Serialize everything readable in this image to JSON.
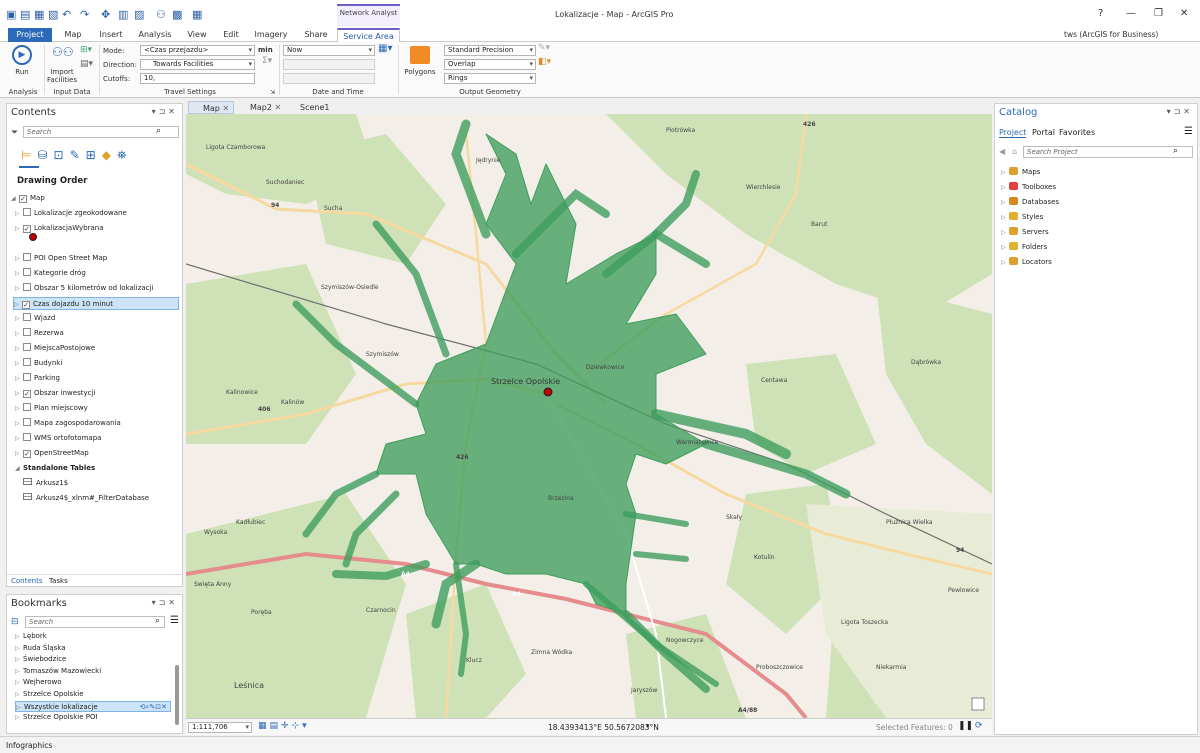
{
  "app": {
    "title": "Lokalizacje - Map - ArcGIS Pro",
    "context_group": "Network Analyst",
    "help": "?",
    "user": "tws (ArcGIS for Business)"
  },
  "ribbon": {
    "tabs": [
      "Project",
      "Map",
      "Insert",
      "Analysis",
      "View",
      "Edit",
      "Imagery",
      "Share",
      "Service Area"
    ],
    "run_label": "Run",
    "import_label": "Import\nFacilities",
    "groups": {
      "analysis": "Analysis",
      "input_data": "Input Data",
      "travel_settings": "Travel Settings",
      "date_time": "Date and Time",
      "output_geometry": "Output Geometry"
    },
    "mode_label": "Mode:",
    "mode_value": "<Czas przejazdu>",
    "mode_unit": "min",
    "direction_label": "Direction:",
    "direction_value": "Towards Facilities",
    "cutoffs_label": "Cutoffs:",
    "cutoffs_value": "10,",
    "date_value": "Now",
    "polygons_label": "Polygons",
    "precision_value": "Standard Precision",
    "overlap_value": "Overlap",
    "rings_value": "Rings"
  },
  "contents": {
    "title": "Contents",
    "search_placeholder": "Search",
    "drawing_order": "Drawing Order",
    "map_label": "Map",
    "layers": [
      {
        "name": "Lokalizacje zgeokodowane",
        "checked": false
      },
      {
        "name": "LokalizacjaWybrana",
        "checked": true
      },
      {
        "name": "POI Open Street Map",
        "checked": false
      },
      {
        "name": "Kategorie dróg",
        "checked": false
      },
      {
        "name": "Obszar 5 kilometrów od lokalizacji",
        "checked": false
      },
      {
        "name": "Czas dojazdu 10 minut",
        "checked": true
      },
      {
        "name": "Wjazd",
        "checked": false
      },
      {
        "name": "Rezerwa",
        "checked": false
      },
      {
        "name": "MiejscaPostojowe",
        "checked": false
      },
      {
        "name": "Budynki",
        "checked": false
      },
      {
        "name": "Parking",
        "checked": false
      },
      {
        "name": "Obszar inwestycji",
        "checked": true
      },
      {
        "name": "Plan miejscowy",
        "checked": false
      },
      {
        "name": "Mapa zagospodarowania",
        "checked": false
      },
      {
        "name": "WMS ortofotomapa",
        "checked": false
      },
      {
        "name": "OpenStreetMap",
        "checked": true
      }
    ],
    "standalone_tables": "Standalone Tables",
    "tables": [
      "Arkusz1$",
      "Arkusz4$_xlnm#_FilterDatabase"
    ],
    "tab_contents": "Contents",
    "tab_tasks": "Tasks"
  },
  "bookmarks": {
    "title": "Bookmarks",
    "search_placeholder": "Search",
    "items": [
      "Lębork",
      "Ruda Śląska",
      "Świebodzice",
      "Tomaszów Mazowiecki",
      "Wejherowo",
      "Strzelce Opolskie",
      "Wszystkie lokalizacje",
      "Strzelce Opolskie POI"
    ]
  },
  "map_tabs": [
    "Map",
    "Map2",
    "Scene1"
  ],
  "map_labels": {
    "city": "Strzelce Opolskie",
    "ligota": "Ligota Czamborowa",
    "suchodaniec": "Suchodaniec",
    "sucha": "Sucha",
    "jedrynie": "Jędrynie",
    "piotrowka": "Piotrówka",
    "wierchlesie": "Wierchlesie",
    "barut": "Barut",
    "szymiszow": "Szymiszów-Osiedle",
    "szymiszow2": "Szymiszów",
    "kalinowice": "Kalinowice",
    "kalinow": "Kalinów",
    "dziewkowice": "Dziewkowice",
    "centawa": "Centawa",
    "dabrowka": "Dąbrówka",
    "warmiatowice": "Warmiątowice",
    "brzezina": "Brzezina",
    "skaly": "Skały",
    "kotulin": "Kotulin",
    "pluznica": "Płużnica Wielka",
    "kadlubiec": "Kadłubiec",
    "wysoka": "Wysoka",
    "swanny": "Swięta Anny",
    "czarnocin": "Czarnocin",
    "poreba": "Poręba",
    "klucz": "Klucz",
    "zimna": "Zimna Wódka",
    "jaryszow": "Jaryszów",
    "lesnica": "Leśnica",
    "ligota_t": "Ligota Toszecka",
    "proboszczowice": "Proboszczowice",
    "niekarmia": "Niekarmia",
    "nogowczyce": "Nogowczyce",
    "pewlowice": "Pewlowice",
    "sucha_w": "Sucha",
    "r426": "426",
    "r94": "94",
    "r406": "406",
    "r426b": "426",
    "rA4": "A4",
    "rA4b": "A4",
    "r94b": "94",
    "rA4c": "A4/88"
  },
  "status": {
    "scale": "1:111,706",
    "coords": "18.4393413°E 50.5672083°N",
    "selected": "Selected Features: 0"
  },
  "catalog": {
    "title": "Catalog",
    "tabs": [
      "Project",
      "Portal",
      "Favorites"
    ],
    "search_placeholder": "Search Project",
    "items": [
      "Maps",
      "Toolboxes",
      "Databases",
      "Styles",
      "Servers",
      "Folders",
      "Locators"
    ]
  },
  "bottom": {
    "infographics": "Infographics"
  },
  "colors": {
    "accent": "#2a6ab8",
    "service_area": "#3f9e5e",
    "tab_highlight": "#6b5fc7"
  }
}
